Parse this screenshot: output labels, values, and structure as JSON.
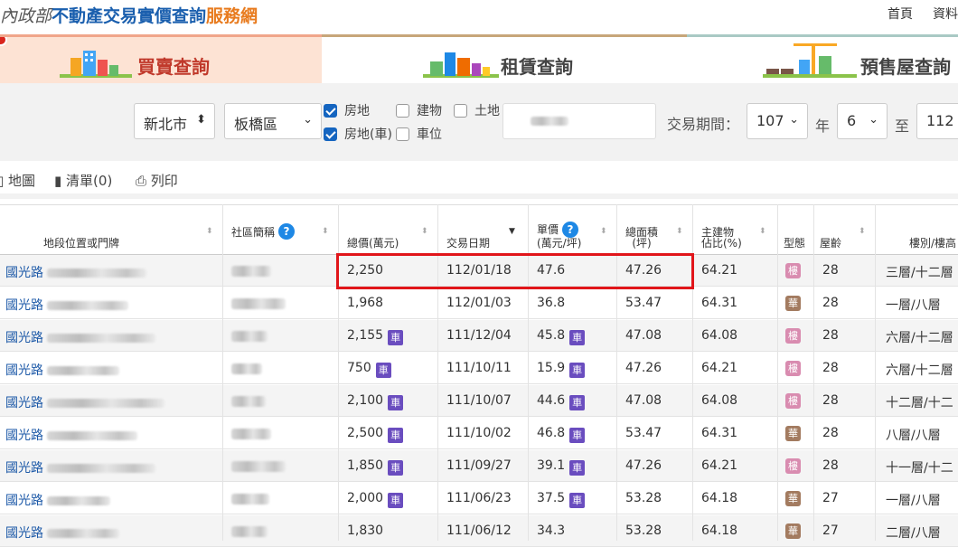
{
  "header": {
    "logo_seal": "內政部",
    "logo_main": "不動產交易實價查詢",
    "logo_service": "服務網",
    "links": [
      "首頁",
      "資料"
    ]
  },
  "tabs": [
    {
      "label": "買賣查詢"
    },
    {
      "label": "租賃查詢"
    },
    {
      "label": "預售屋查詢"
    }
  ],
  "filter": {
    "city": "新北市",
    "district": "板橋區",
    "options": [
      {
        "label": "房地",
        "checked": true
      },
      {
        "label": "建物",
        "checked": false
      },
      {
        "label": "土地",
        "checked": false
      },
      {
        "label": "房地(車)",
        "checked": true
      },
      {
        "label": "車位",
        "checked": false
      }
    ],
    "period_label": "交易期間：",
    "start_year": "107",
    "year_unit": "年",
    "start_month": "6",
    "to_label": "至",
    "end_year": "112"
  },
  "toolbar": {
    "map": "地圖",
    "list": "清單(0)",
    "print": "列印"
  },
  "columns": {
    "location": "地段位置或門牌",
    "community": "社區簡稱",
    "total_price": "總價(萬元)",
    "date": "交易日期",
    "unit_price_1": "單價",
    "unit_price_2": "(萬元/坪)",
    "area_1": "總面積",
    "area_2": "(坪)",
    "ratio_1": "主建物",
    "ratio_2": "佔比(%)",
    "type": "型態",
    "age": "屋齡",
    "floor": "樓別/樓高"
  },
  "car_badge": "車",
  "rows": [
    {
      "road": "國光路",
      "total": "2,250",
      "car_total": false,
      "date": "112/01/18",
      "unit": "47.6",
      "car_unit": false,
      "area": "47.26",
      "ratio": "64.21",
      "type": "樓",
      "age": "28",
      "floor": "三層/十二層"
    },
    {
      "road": "國光路",
      "total": "1,968",
      "car_total": false,
      "date": "112/01/03",
      "unit": "36.8",
      "car_unit": false,
      "area": "53.47",
      "ratio": "64.31",
      "type": "華",
      "age": "28",
      "floor": "一層/八層"
    },
    {
      "road": "國光路",
      "total": "2,155",
      "car_total": true,
      "date": "111/12/04",
      "unit": "45.8",
      "car_unit": true,
      "area": "47.08",
      "ratio": "64.08",
      "type": "樓",
      "age": "28",
      "floor": "六層/十二層"
    },
    {
      "road": "國光路",
      "total": "750",
      "car_total": true,
      "date": "111/10/11",
      "unit": "15.9",
      "car_unit": true,
      "area": "47.26",
      "ratio": "64.21",
      "type": "樓",
      "age": "28",
      "floor": "六層/十二層"
    },
    {
      "road": "國光路",
      "total": "2,100",
      "car_total": true,
      "date": "111/10/07",
      "unit": "44.6",
      "car_unit": true,
      "area": "47.08",
      "ratio": "64.08",
      "type": "樓",
      "age": "28",
      "floor": "十二層/十二"
    },
    {
      "road": "國光路",
      "total": "2,500",
      "car_total": true,
      "date": "111/10/02",
      "unit": "46.8",
      "car_unit": true,
      "area": "53.47",
      "ratio": "64.31",
      "type": "華",
      "age": "28",
      "floor": "八層/八層"
    },
    {
      "road": "國光路",
      "total": "1,850",
      "car_total": true,
      "date": "111/09/27",
      "unit": "39.1",
      "car_unit": true,
      "area": "47.26",
      "ratio": "64.21",
      "type": "樓",
      "age": "28",
      "floor": "十一層/十二"
    },
    {
      "road": "國光路",
      "total": "2,000",
      "car_total": true,
      "date": "111/06/23",
      "unit": "37.5",
      "car_unit": true,
      "area": "53.28",
      "ratio": "64.18",
      "type": "華",
      "age": "27",
      "floor": "一層/八層"
    },
    {
      "road": "國光路",
      "total": "1,830",
      "car_total": false,
      "date": "111/06/12",
      "unit": "34.3",
      "car_unit": false,
      "area": "53.28",
      "ratio": "64.18",
      "type": "華",
      "age": "27",
      "floor": "二層/八層"
    }
  ]
}
